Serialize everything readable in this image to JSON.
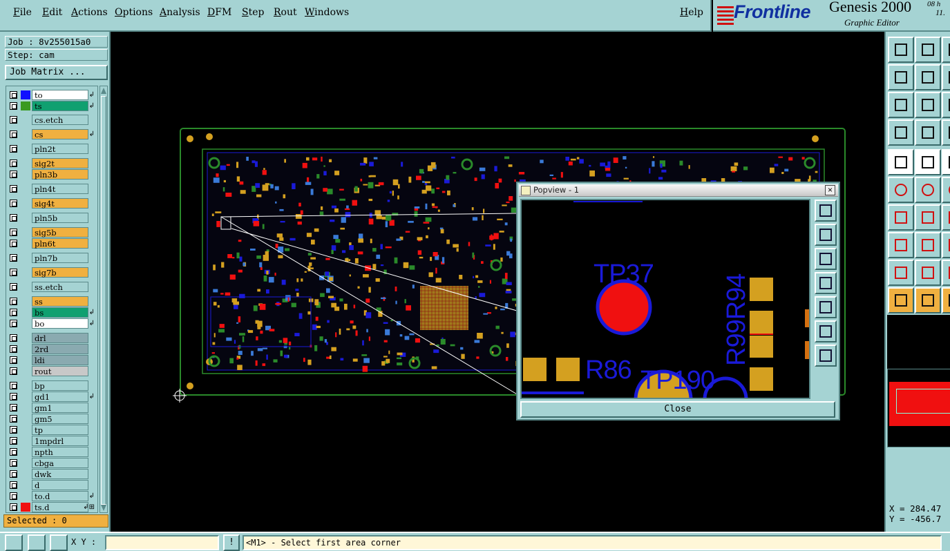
{
  "menu": {
    "file": "File",
    "edit": "Edit",
    "actions": "Actions",
    "options": "Options",
    "analysis": "Analysis",
    "dfm": "DFM",
    "step": "Step",
    "rout": "Rout",
    "windows": "Windows",
    "help": "Help"
  },
  "logo": {
    "brand": "Frontline",
    "product": "Genesis 2000",
    "subtitle": "Graphic Editor",
    "date_fragment": "08 h",
    "time_fragment": "11."
  },
  "job": {
    "job_label": "Job : 8v255015a0",
    "step_label": "Step: cam",
    "job_matrix_button": "Job Matrix ..."
  },
  "layers": [
    {
      "name": "to",
      "color": "#ffffff",
      "swatch": "#1010ff",
      "arrow": "↲"
    },
    {
      "name": "ts",
      "color": "#10a070",
      "swatch": "#3a9a20",
      "arrow": "↲"
    },
    {
      "name": "cs.etch",
      "color": "#a5d3d3",
      "swatch": "",
      "arrow": ""
    },
    {
      "name": "cs",
      "color": "#f0b040",
      "swatch": "",
      "arrow": "↲"
    },
    {
      "name": "pln2t",
      "color": "#a5d3d3",
      "swatch": "",
      "arrow": ""
    },
    {
      "name": "sig2t",
      "color": "#f0b040",
      "swatch": "",
      "arrow": ""
    },
    {
      "name": "pln3b",
      "color": "#f0b040",
      "swatch": "",
      "arrow": ""
    },
    {
      "name": "pln4t",
      "color": "#a5d3d3",
      "swatch": "",
      "arrow": ""
    },
    {
      "name": "sig4t",
      "color": "#f0b040",
      "swatch": "",
      "arrow": ""
    },
    {
      "name": "pln5b",
      "color": "#a5d3d3",
      "swatch": "",
      "arrow": ""
    },
    {
      "name": "sig5b",
      "color": "#f0b040",
      "swatch": "",
      "arrow": ""
    },
    {
      "name": "pln6t",
      "color": "#f0b040",
      "swatch": "",
      "arrow": ""
    },
    {
      "name": "pln7b",
      "color": "#a5d3d3",
      "swatch": "",
      "arrow": ""
    },
    {
      "name": "sig7b",
      "color": "#f0b040",
      "swatch": "",
      "arrow": ""
    },
    {
      "name": "ss.etch",
      "color": "#a5d3d3",
      "swatch": "",
      "arrow": ""
    },
    {
      "name": "ss",
      "color": "#f0b040",
      "swatch": "",
      "arrow": ""
    },
    {
      "name": "bs",
      "color": "#10a070",
      "swatch": "",
      "arrow": "↲"
    },
    {
      "name": "bo",
      "color": "#ffffff",
      "swatch": "",
      "arrow": "↲"
    },
    {
      "name": "drl",
      "color": "#8aaab0",
      "swatch": "",
      "arrow": ""
    },
    {
      "name": "2rd",
      "color": "#8aaab0",
      "swatch": "",
      "arrow": ""
    },
    {
      "name": "ldi",
      "color": "#8aaab0",
      "swatch": "",
      "arrow": ""
    },
    {
      "name": "rout",
      "color": "#c8c8c8",
      "swatch": "",
      "arrow": ""
    },
    {
      "name": "bp",
      "color": "#a5d3d3",
      "swatch": "",
      "arrow": ""
    },
    {
      "name": "gd1",
      "color": "#a5d3d3",
      "swatch": "",
      "arrow": "↲"
    },
    {
      "name": "gm1",
      "color": "#a5d3d3",
      "swatch": "",
      "arrow": ""
    },
    {
      "name": "gm5",
      "color": "#a5d3d3",
      "swatch": "",
      "arrow": ""
    },
    {
      "name": "tp",
      "color": "#a5d3d3",
      "swatch": "",
      "arrow": ""
    },
    {
      "name": "1mpdrl",
      "color": "#a5d3d3",
      "swatch": "",
      "arrow": ""
    },
    {
      "name": "npth",
      "color": "#a5d3d3",
      "swatch": "",
      "arrow": ""
    },
    {
      "name": "cbga",
      "color": "#a5d3d3",
      "swatch": "",
      "arrow": ""
    },
    {
      "name": "dwk",
      "color": "#a5d3d3",
      "swatch": "",
      "arrow": ""
    },
    {
      "name": "d",
      "color": "#a5d3d3",
      "swatch": "",
      "arrow": ""
    },
    {
      "name": "to.d",
      "color": "#a5d3d3",
      "swatch": "",
      "arrow": "↲"
    },
    {
      "name": "ts.d",
      "color": "#a5d3d3",
      "swatch": "#f01010",
      "arrow": "↲⊞"
    }
  ],
  "selected": "Selected : 0",
  "popview": {
    "title": "Popview - 1",
    "close_label": "Close",
    "labels": {
      "tp37": "TP37",
      "r99r94": "R99R94",
      "r86": "R86",
      "tp190": "TP190"
    }
  },
  "coords": {
    "x": "X = 284.47",
    "y": "Y = -456.7"
  },
  "status": {
    "xy_label": "X Y :",
    "xy_value": "",
    "info_button": "!",
    "prompt": "<M1> - Select first area corner"
  },
  "colors": {
    "panel": "#a5d3d3",
    "copper": "#d4a020",
    "outline": "#2a8a2a",
    "trace": "#1a1ad8",
    "highlight": "#f01010"
  },
  "icons": {
    "window-icon": "popview-window-icon",
    "close-icon": "x"
  }
}
